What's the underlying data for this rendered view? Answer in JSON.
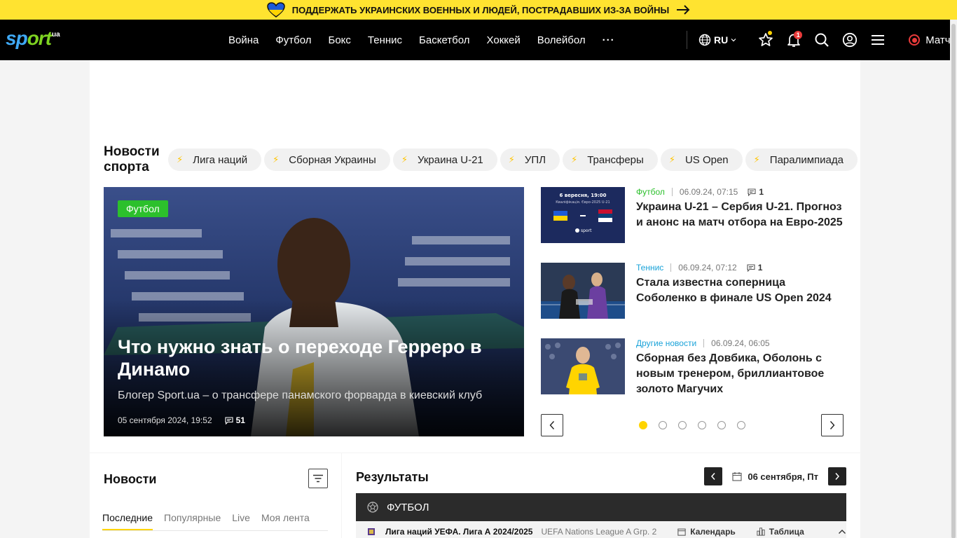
{
  "banner": {
    "text": "ПОДДЕРЖАТЬ УКРАИНСКИХ ВОЕННЫХ И ЛЮДЕЙ, ПОСТРАДАВШИХ ИЗ-ЗА ВОЙНЫ"
  },
  "header": {
    "logo": {
      "part1": "sp",
      "part2": "ort",
      "part3": "ua"
    },
    "nav": [
      "Война",
      "Футбол",
      "Бокс",
      "Теннис",
      "Баскетбол",
      "Хоккей",
      "Волейбол"
    ],
    "more": "···",
    "lang": "RU",
    "notifications_count": "1",
    "matches_label": "Матчи"
  },
  "sports_news": {
    "title": "Новости спорта",
    "chips": [
      "Лига наций",
      "Сборная Украины",
      "Украина U-21",
      "УПЛ",
      "Трансферы",
      "US Open",
      "Паралимпиада"
    ]
  },
  "hero": {
    "tag": "Футбол",
    "title": "Что нужно знать о переходе Герреро в Динамо",
    "subtitle": "Блогер Sport.ua – о трансфере панамского форварда в киевский клуб",
    "date": "05 сентября 2024, 19:52",
    "comments": "51"
  },
  "side_news": [
    {
      "category": "Футбол",
      "category_color": "#2cc02c",
      "date": "06.09.24, 07:15",
      "comments": "1",
      "title": "Украина U-21 – Сербия U-21. Прогноз и анонс на матч отбора на Евро-2025"
    },
    {
      "category": "Теннис",
      "category_color": "#1aa3d9",
      "date": "06.09.24, 07:12",
      "comments": "1",
      "title": "Стала известна соперница Соболенко в финале US Open 2024"
    },
    {
      "category": "Другие новости",
      "category_color": "#1aa3d9",
      "date": "06.09.24, 06:05",
      "comments": "",
      "title": "Сборная без Довбика, Оболонь с новым тренером, бриллиантовое золото Магучих"
    }
  ],
  "thumb_texts": {
    "t1_line1": "6 вересня, 19:00",
    "t1_line2": "Кваліфікація. Євро-2025 U-21",
    "t1_brand": "sport"
  },
  "news": {
    "title": "Новости",
    "tabs": [
      "Последние",
      "Популярные",
      "Live",
      "Моя лента"
    ]
  },
  "results": {
    "title": "Результаты",
    "date": "06 сентября, Пт",
    "sport": "ФУТБОЛ",
    "league": "Лига наций УЕФА. Лига А 2024/2025",
    "league_sub": "UEFA Nations League A Grp. 2",
    "calendar": "Календарь",
    "table": "Таблица"
  }
}
